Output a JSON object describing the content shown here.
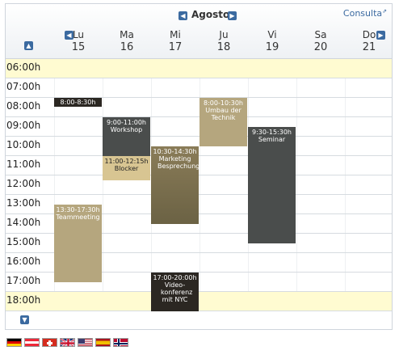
{
  "header": {
    "month": "Agosto",
    "consult_label": "Consulta",
    "prev_icon": "arrow-left-icon",
    "next_icon": "arrow-right-icon",
    "up_icon": "arrow-up-icon",
    "down_icon": "arrow-down-icon"
  },
  "days": [
    {
      "name": "Lu",
      "date": "15"
    },
    {
      "name": "Ma",
      "date": "16"
    },
    {
      "name": "Mi",
      "date": "17"
    },
    {
      "name": "Ju",
      "date": "18"
    },
    {
      "name": "Vi",
      "date": "19"
    },
    {
      "name": "Sa",
      "date": "20"
    },
    {
      "name": "Do",
      "date": "21"
    }
  ],
  "hours": [
    "06:00h",
    "07:00h",
    "08:00h",
    "09:00h",
    "10:00h",
    "11:00h",
    "12:00h",
    "13:00h",
    "14:00h",
    "15:00h",
    "16:00h",
    "17:00h",
    "18:00h"
  ],
  "events": [
    {
      "time": "8:00-8:30h",
      "title": ""
    },
    {
      "time": "9:00-11:00h",
      "title": "Workshop"
    },
    {
      "time": "11:00-12:15h",
      "title": "Blocker"
    },
    {
      "time": "13:30-17:30h",
      "title": "Teammeeting"
    },
    {
      "time": "10:30-14:30h",
      "title": "Marketing Besprechung"
    },
    {
      "time": "17:00-20:00h",
      "title": "Video-konferenz mit NYC"
    },
    {
      "time": "8:00-10:30h",
      "title": "Umbau der Technik"
    },
    {
      "time": "9:30-15:30h",
      "title": "Seminar"
    }
  ],
  "colors": {
    "nav_blue": "#3b6aa0",
    "highlight_row": "#fffbd1",
    "dark_event": "#2b2722",
    "slate_event": "#4a4d4c",
    "tan_event": "#b5a67e",
    "light_tan_event": "#d8c592"
  },
  "languages": [
    "german-flag-icon",
    "austrian-flag-icon",
    "swiss-flag-icon",
    "uk-flag-icon",
    "us-flag-icon",
    "spanish-flag-icon",
    "norwegian-flag-icon"
  ]
}
